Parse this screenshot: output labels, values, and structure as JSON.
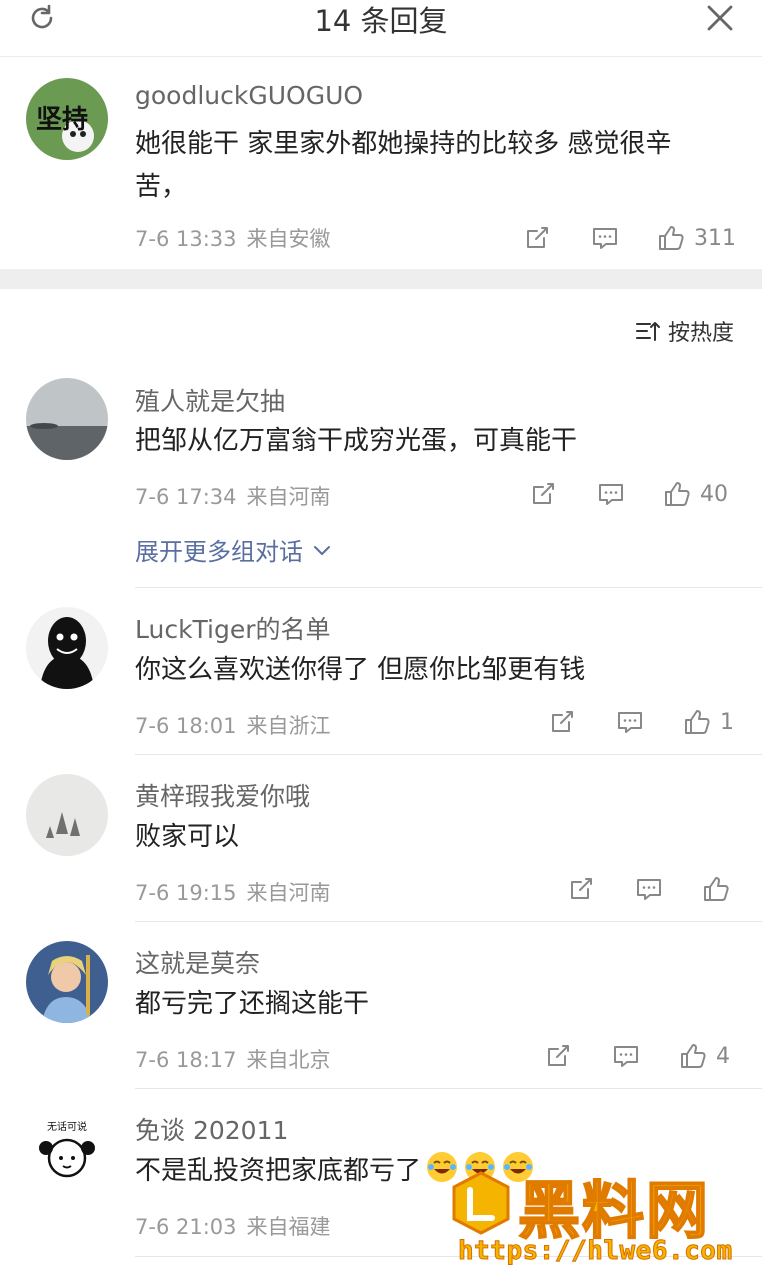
{
  "header": {
    "title": "14 条回复",
    "refresh_icon": "refresh-icon",
    "close_icon": "close-icon"
  },
  "root": {
    "user": "goodluckGUOGUO",
    "text": "她很能干 家里家外都她操持的比较多 感觉很辛苦，",
    "date": "7-6 13:33",
    "location": "来自安徽",
    "likes": "311"
  },
  "sort": {
    "label": "按热度",
    "icon": "sort-icon"
  },
  "replies": [
    {
      "user": "殖人就是欠抽",
      "text": "把邹从亿万富翁干成穷光蛋，可真能干",
      "date": "7-6 17:34",
      "location": "来自河南",
      "likes": "40"
    },
    {
      "user": "LuckTiger的名单",
      "text": "你这么喜欢送你得了 但愿你比邹更有钱",
      "date": "7-6 18:01",
      "location": "来自浙江",
      "likes": "1"
    },
    {
      "user": "黄梓瑕我爱你哦",
      "text": "败家可以",
      "date": "7-6 19:15",
      "location": "来自河南",
      "likes": ""
    },
    {
      "user": "这就是莫奈",
      "text": "都亏完了还搁这能干",
      "date": "7-6 18:17",
      "location": "来自北京",
      "likes": "4"
    },
    {
      "user": "免谈 202011",
      "text": "不是乱投资把家底都亏了",
      "date": "7-6 21:03",
      "location": "来自福建",
      "likes": ""
    }
  ],
  "expand_label": "展开更多组对话",
  "avatar_texts": {
    "root": "坚持",
    "last": "无话可说"
  },
  "watermark": {
    "title": "黑料网",
    "url": "https://hlwe6.com"
  },
  "colors": {
    "link": "#5a6fa0",
    "meta": "#999999",
    "watermark": "#f5b400"
  }
}
